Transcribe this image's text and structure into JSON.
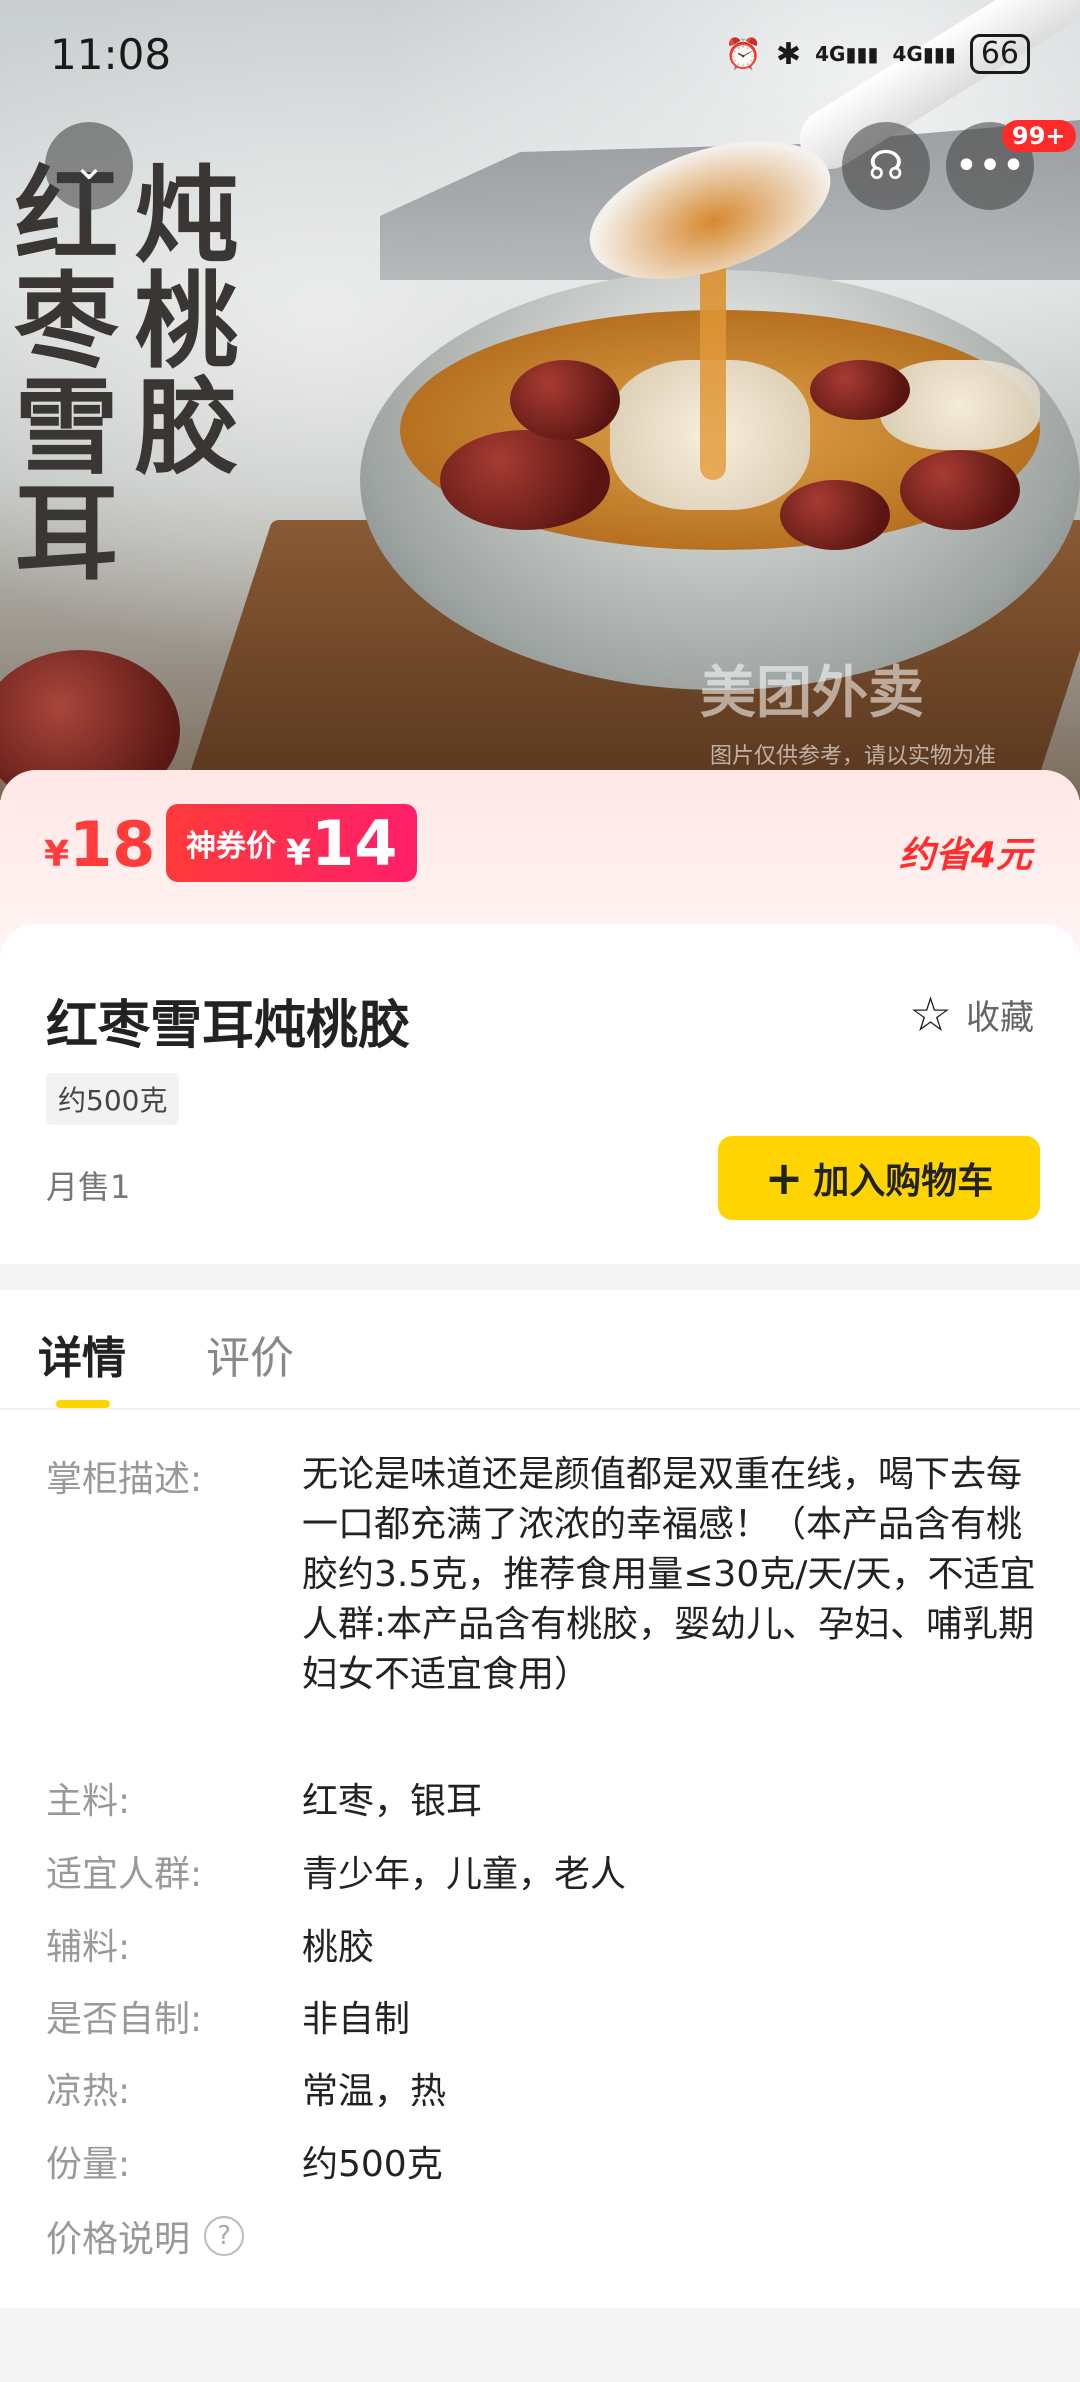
{
  "status_bar": {
    "time": "11:08",
    "network1": "4G",
    "network2": "4G",
    "battery": "66"
  },
  "hero": {
    "title_col1": "炖桃胶",
    "title_col2": "红枣雪耳",
    "watermark": "美团外卖",
    "watermark_note": "图片仅供参考，请以实物为准",
    "badge": "99+"
  },
  "price": {
    "original_symbol": "¥",
    "original": "18",
    "coupon_label": "神券价",
    "coupon_symbol": "¥",
    "coupon_price": "14",
    "save": "约省4元"
  },
  "product": {
    "name": "红枣雪耳炖桃胶",
    "favorite_label": "收藏",
    "spec": "约500克",
    "sales": "月售1",
    "cart_label": "加入购物车"
  },
  "tabs": [
    "详情",
    "评价"
  ],
  "details": {
    "desc_label": "掌柜描述:",
    "desc": "无论是味道还是颜值都是双重在线，喝下去每一口都充满了浓浓的幸福感！（本产品含有桃胶约3.5克，推荐食用量≤30克/天/天，不适宜人群:本产品含有桃胶，婴幼儿、孕妇、哺乳期妇女不适宜食用）",
    "rows": [
      {
        "label": "主料:",
        "value": "红枣，银耳"
      },
      {
        "label": "适宜人群:",
        "value": "青少年，儿童，老人"
      },
      {
        "label": "辅料:",
        "value": "桃胶"
      },
      {
        "label": "是否自制:",
        "value": "非自制"
      },
      {
        "label": "凉热:",
        "value": "常温，热"
      },
      {
        "label": "份量:",
        "value": "约500克"
      }
    ],
    "price_note": "价格说明",
    "price_note_icon": "?"
  },
  "colors": {
    "accent_red": "#ff3b3b",
    "cart_yellow": "#ffd400"
  }
}
